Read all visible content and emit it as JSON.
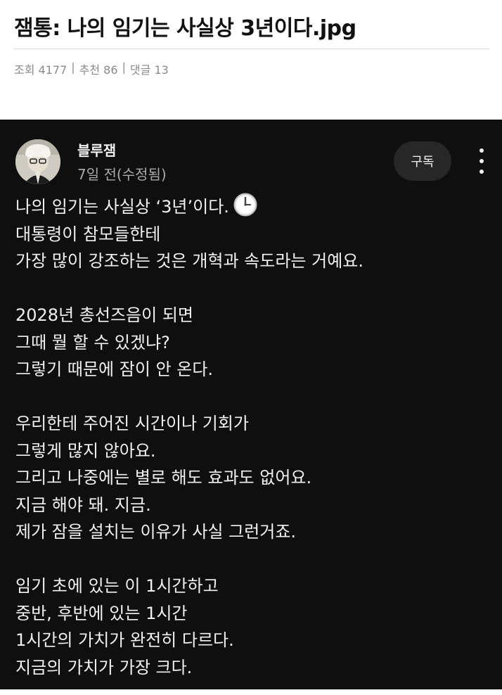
{
  "post": {
    "title": "잼통: 나의 임기는 사실상 3년이다.jpg",
    "views": "조회 4177",
    "recommends": "추천 86",
    "comments": "댓글 13",
    "separator": "|"
  },
  "community_post": {
    "author": "블루잼",
    "time": "7일 전(수정됨)",
    "subscribe_label": "구독",
    "avatar_icon": "avatar-photo-icon",
    "clock_icon": "clock-face-icon",
    "paragraphs": [
      [
        "나의 임기는 사실상 ‘3년’이다.",
        "대통령이 참모들한테",
        "가장 많이 강조하는 것은 개혁과 속도라는 거예요."
      ],
      [
        "2028년 총선즈음이 되면",
        "그때 뭘 할 수 있겠냐?",
        "그렇기 때문에 잠이 안 온다."
      ],
      [
        "우리한테 주어진 시간이나 기회가",
        "그렇게 많지 않아요.",
        "그리고 나중에는 별로 해도 효과도 없어요.",
        "지금 해야 돼. 지금.",
        "제가 잠을 설치는 이유가 사실 그런거죠."
      ],
      [
        "임기 초에 있는 이 1시간하고",
        "중반, 후반에 있는 1시간",
        "1시간의 가치가 완전히 다르다.",
        "지금의 가치가 가장 크다."
      ]
    ]
  },
  "colors": {
    "dark_bg": "#0f0f0f",
    "text_light": "#f1f1f1",
    "text_muted": "#aaaaaa",
    "button_bg": "#272727",
    "meta_gray": "#8a8a8a"
  }
}
